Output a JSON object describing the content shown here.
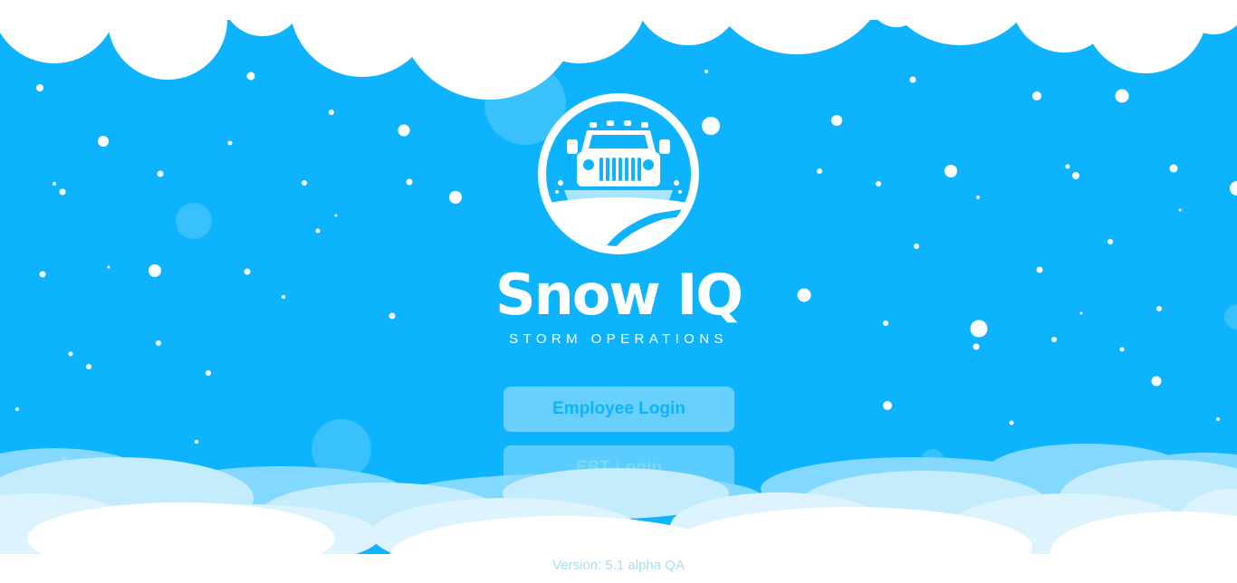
{
  "app": {
    "title": "Snow IQ",
    "subtitle": "STORM OPERATIONS",
    "logo_icon": "snowplow-truck-icon"
  },
  "buttons": {
    "employee_login": "Employee Login",
    "ebt_login": "EBT Login"
  },
  "footer": {
    "version": "Version: 5.1 alpha QA"
  },
  "colors": {
    "sky": "#0db4fd",
    "cloud": "#ffffff",
    "button_text": "#0db4fd"
  }
}
